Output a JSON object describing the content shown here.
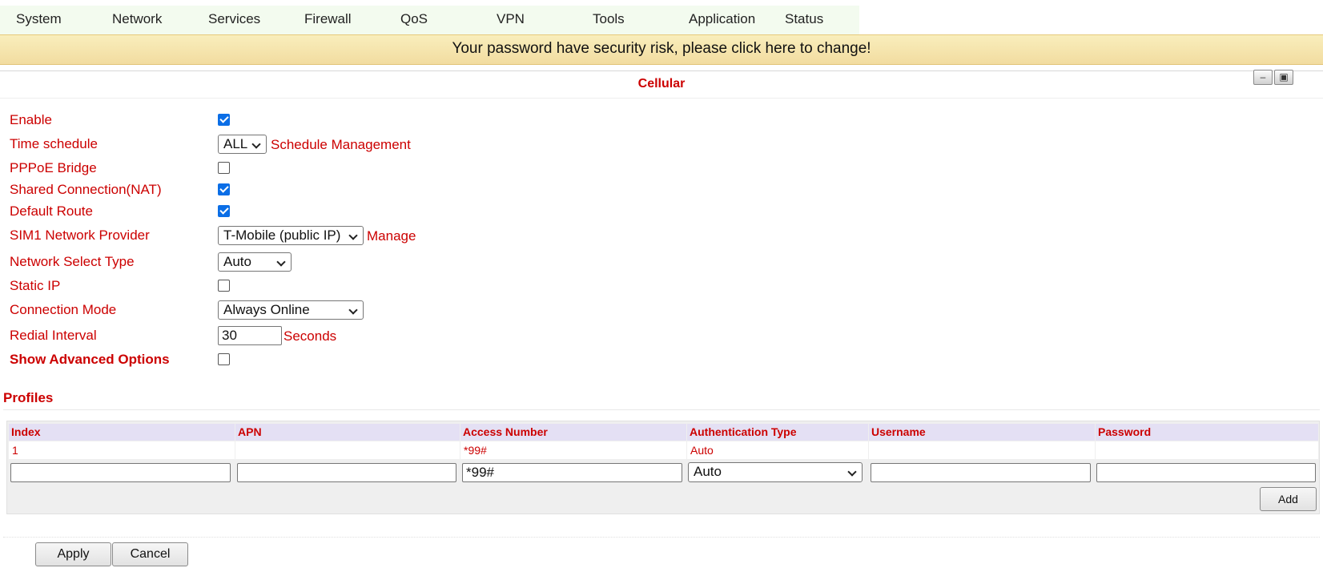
{
  "nav": [
    "System",
    "Network",
    "Services",
    "Firewall",
    "QoS",
    "VPN",
    "Tools",
    "Application",
    "Status"
  ],
  "banner": "Your password have security risk, please click here to change!",
  "panel": {
    "title": "Cellular",
    "minimize_icon": "minimize-icon",
    "restore_icon": "restore-icon"
  },
  "form": {
    "enable": {
      "label": "Enable",
      "checked": true
    },
    "time_schedule": {
      "label": "Time schedule",
      "value": "ALL",
      "link": "Schedule Management"
    },
    "pppoe_bridge": {
      "label": "PPPoE Bridge",
      "checked": false
    },
    "shared_connection": {
      "label": "Shared Connection(NAT)",
      "checked": true
    },
    "default_route": {
      "label": "Default Route",
      "checked": true
    },
    "sim1_provider": {
      "label": "SIM1 Network Provider",
      "value": "T-Mobile (public IP)",
      "link": "Manage"
    },
    "network_select_type": {
      "label": "Network Select Type",
      "value": "Auto"
    },
    "static_ip": {
      "label": "Static IP",
      "checked": false
    },
    "connection_mode": {
      "label": "Connection Mode",
      "value": "Always Online"
    },
    "redial_interval": {
      "label": "Redial Interval",
      "value": "30",
      "unit": "Seconds"
    },
    "show_advanced": {
      "label": "Show Advanced Options",
      "checked": false
    }
  },
  "profiles": {
    "title": "Profiles",
    "columns": [
      "Index",
      "APN",
      "Access Number",
      "Authentication Type",
      "Username",
      "Password"
    ],
    "rows": [
      {
        "index": "1",
        "apn": "",
        "access_number": "*99#",
        "auth_type": "Auto",
        "username": "",
        "password": ""
      }
    ],
    "new_row": {
      "index": "",
      "apn": "",
      "access_number": "*99#",
      "auth_type": "Auto",
      "username": "",
      "password": ""
    },
    "add_label": "Add"
  },
  "buttons": {
    "apply": "Apply",
    "cancel": "Cancel"
  }
}
